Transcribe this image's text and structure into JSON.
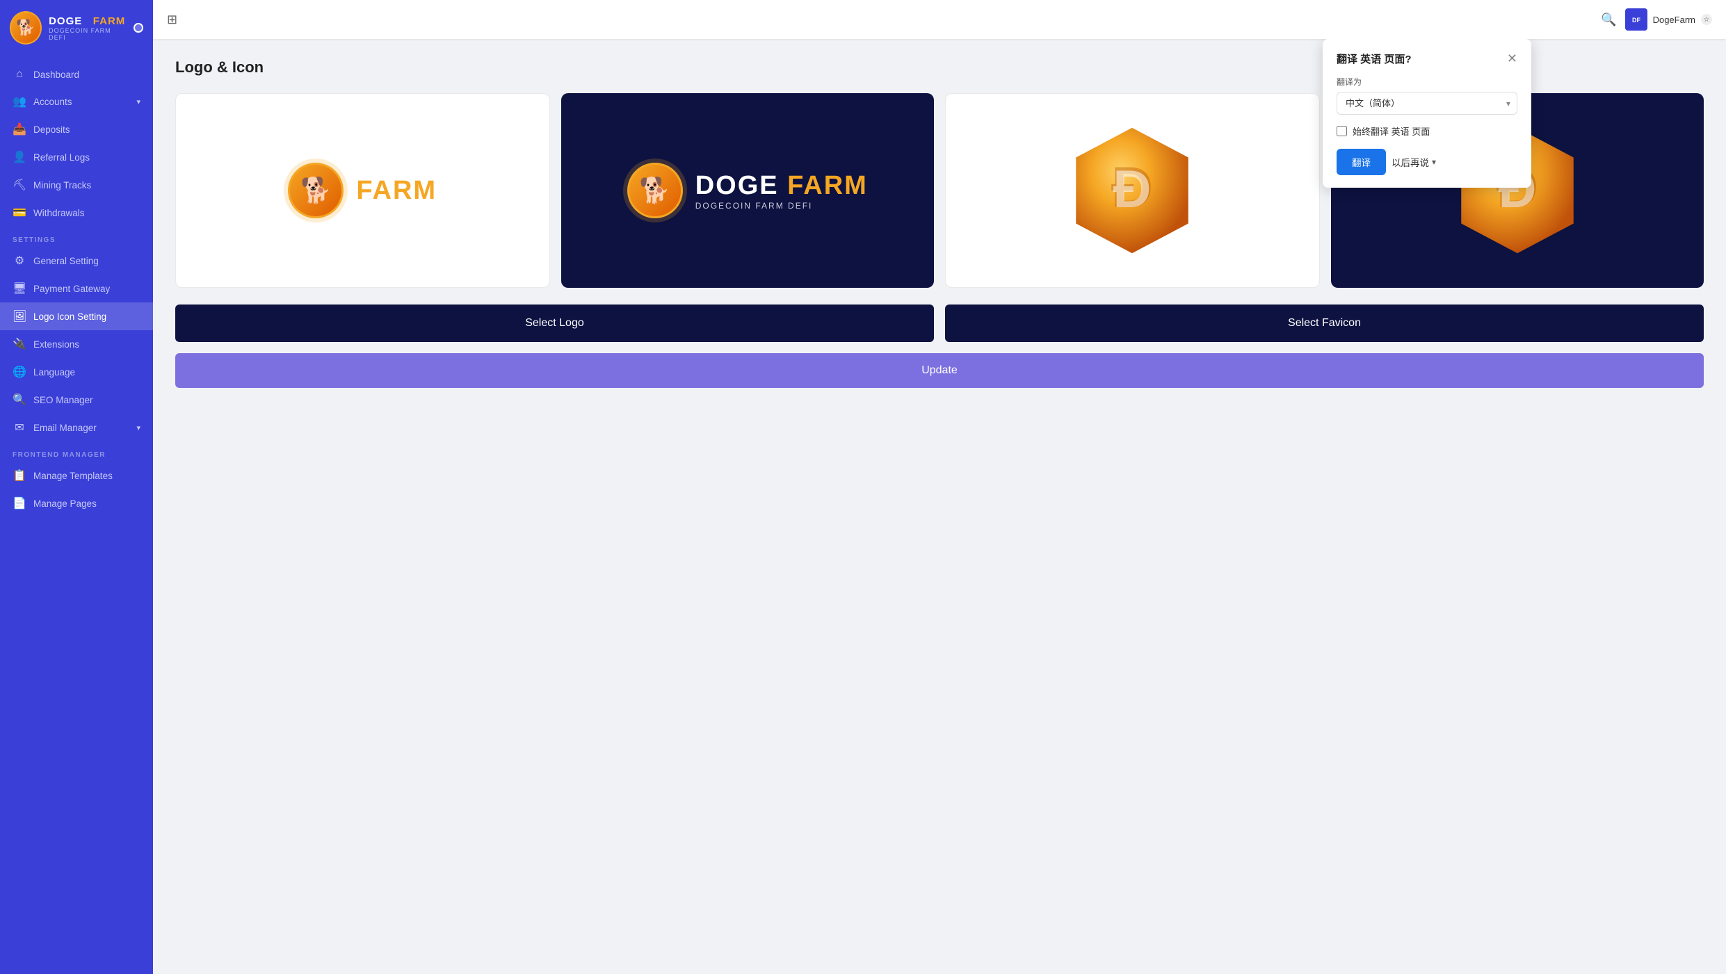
{
  "brand": {
    "icon": "🐕",
    "name_white": "DOGE",
    "name_yellow": "FARM",
    "subtitle": "DOGECOIN FARM DEFI"
  },
  "sidebar": {
    "nav_items": [
      {
        "id": "dashboard",
        "label": "Dashboard",
        "icon": "⌂",
        "active": false
      },
      {
        "id": "accounts",
        "label": "Accounts",
        "icon": "👥",
        "active": false,
        "has_chevron": true
      },
      {
        "id": "deposits",
        "label": "Deposits",
        "icon": "📥",
        "active": false
      },
      {
        "id": "referral-logs",
        "label": "Referral Logs",
        "icon": "👤",
        "active": false
      },
      {
        "id": "mining-tracks",
        "label": "Mining Tracks",
        "icon": "⛏",
        "active": false
      },
      {
        "id": "withdrawals",
        "label": "Withdrawals",
        "icon": "💳",
        "active": false
      }
    ],
    "settings_label": "SETTINGS",
    "settings_items": [
      {
        "id": "general-setting",
        "label": "General Setting",
        "icon": "⚙"
      },
      {
        "id": "payment-gateway",
        "label": "Payment Gateway",
        "icon": "🖥"
      },
      {
        "id": "logo-icon-setting",
        "label": "Logo Icon Setting",
        "icon": "🖼",
        "active": true
      }
    ],
    "more_settings": [
      {
        "id": "extensions",
        "label": "Extensions",
        "icon": "🔌"
      },
      {
        "id": "language",
        "label": "Language",
        "icon": "🌐"
      },
      {
        "id": "seo-manager",
        "label": "SEO Manager",
        "icon": "🔍"
      },
      {
        "id": "email-manager",
        "label": "Email Manager",
        "icon": "✉",
        "has_chevron": true
      }
    ],
    "frontend_label": "FRONTEND MANAGER",
    "frontend_items": [
      {
        "id": "manage-templates",
        "label": "Manage Templates",
        "icon": "📋"
      },
      {
        "id": "manage-pages",
        "label": "Manage Pages",
        "icon": "📄"
      }
    ]
  },
  "topbar": {
    "expand_icon": "⊞",
    "user_name": "DogeFarm",
    "user_initials": "DF"
  },
  "page": {
    "title": "Logo & Icon"
  },
  "logo_cards": [
    {
      "id": "light-logo",
      "type": "light"
    },
    {
      "id": "dark-logo",
      "type": "dark"
    },
    {
      "id": "light-icon",
      "type": "icon-light"
    },
    {
      "id": "dark-icon",
      "type": "icon-dark"
    }
  ],
  "buttons": {
    "select_logo": "Select Logo",
    "select_favicon": "Select Favicon",
    "update": "Update"
  },
  "translate_popup": {
    "title": "翻译 英语 页面?",
    "label": "翻译为",
    "selected_lang": "中文（简体）",
    "checkbox_label": "始终翻译 英语 页面",
    "btn_translate": "翻译",
    "btn_later": "以后再说"
  }
}
